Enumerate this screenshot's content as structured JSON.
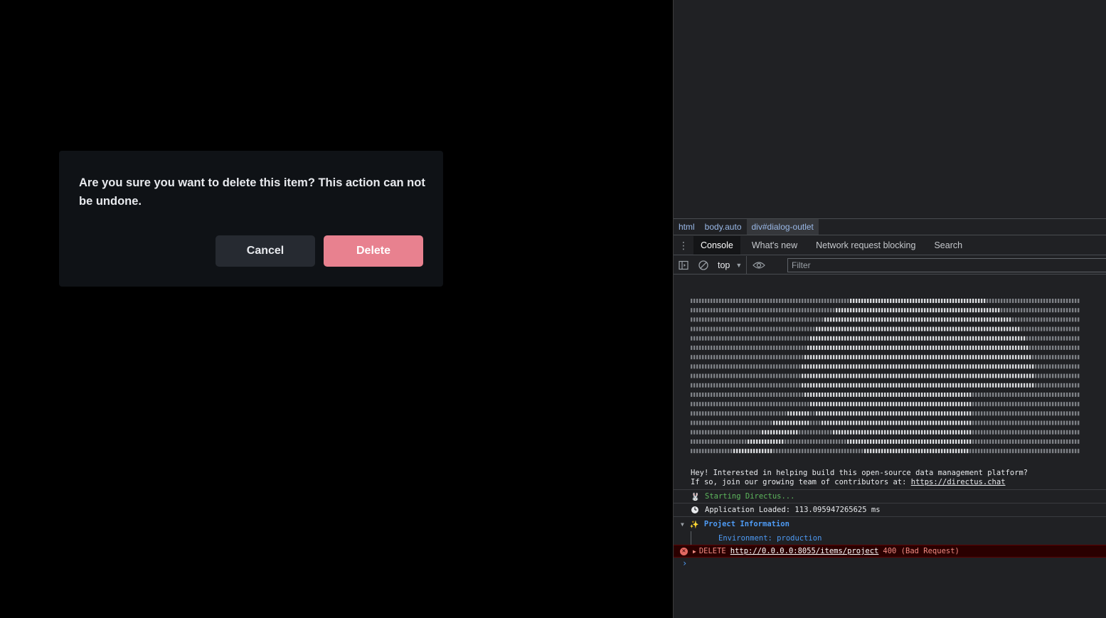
{
  "dialog": {
    "message": "Are you sure you want to delete this item? This action can not be undone.",
    "cancel_label": "Cancel",
    "delete_label": "Delete"
  },
  "devtools": {
    "breadcrumb": [
      "html",
      "body.auto",
      "div#dialog-outlet"
    ],
    "tabs": [
      "Console",
      "What's new",
      "Network request blocking",
      "Search"
    ],
    "context": "top",
    "filter_placeholder": "Filter",
    "console": {
      "hey_line1": "Hey! Interested in helping build this open-source data management platform?",
      "hey_line2": "If so, join our growing team of contributors at: ",
      "hey_link": "https://directus.chat",
      "starting": "Starting Directus...",
      "loaded": "Application Loaded: 113.095947265625 ms",
      "project_info": "Project Information",
      "environment": "Environment: production",
      "error_method": "DELETE",
      "error_url": "http://0.0.0.0:8055/items/project",
      "error_status": "400 (Bad Request)",
      "prompt": "›"
    }
  },
  "colors": {
    "delete_button": "#e8818f",
    "cancel_button": "#262a31",
    "dialog_bg": "#0f1216",
    "devtools_bg": "#202124",
    "link_blue": "#4e9bf5",
    "error_bg": "#2a0000"
  },
  "icons": {
    "kebab": "kebab-menu-icon",
    "sidebar": "sidebar-toggle-icon",
    "clear": "clear-console-icon",
    "eye": "live-expression-eye-icon",
    "rabbit": "rabbit-icon",
    "clock": "clock-icon",
    "sparkles": "sparkles-icon",
    "error": "error-icon"
  }
}
